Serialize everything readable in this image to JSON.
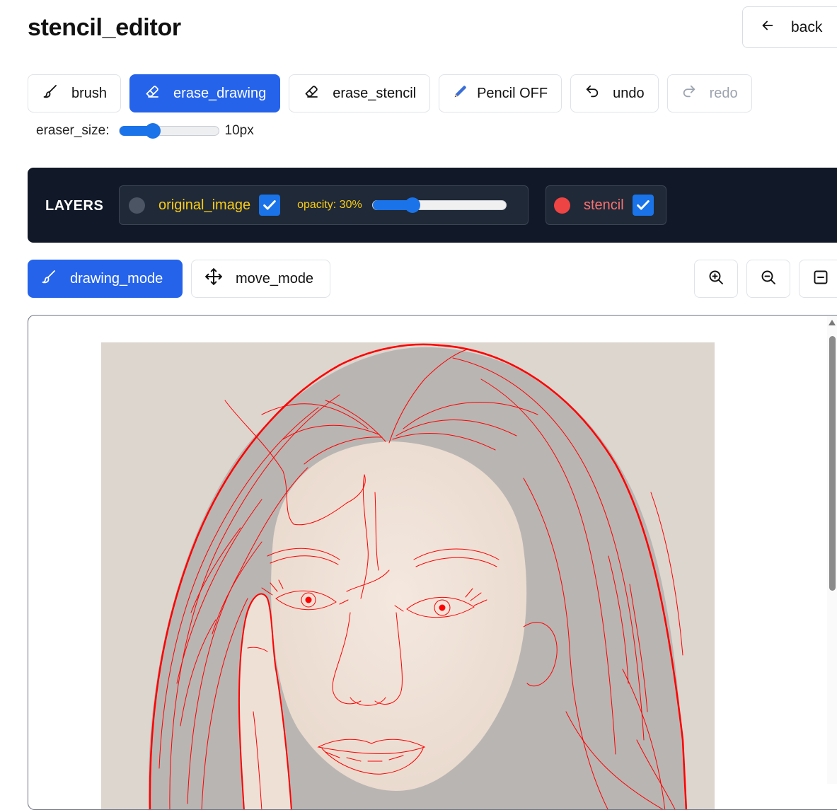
{
  "header": {
    "title": "stencil_editor",
    "back_label": "back"
  },
  "tools": [
    {
      "id": "brush",
      "label": "brush",
      "icon": "brush-icon",
      "state": "normal"
    },
    {
      "id": "erase_drawing",
      "label": "erase_drawing",
      "icon": "eraser-icon",
      "state": "active"
    },
    {
      "id": "erase_stencil",
      "label": "erase_stencil",
      "icon": "eraser-icon",
      "state": "normal"
    },
    {
      "id": "pencil",
      "label": "Pencil OFF",
      "icon": "pencil-icon",
      "state": "normal"
    },
    {
      "id": "undo",
      "label": "undo",
      "icon": "undo-icon",
      "state": "normal"
    },
    {
      "id": "redo",
      "label": "redo",
      "icon": "redo-icon",
      "state": "disabled"
    }
  ],
  "eraser": {
    "label": "eraser_size:",
    "value_text": "10px",
    "level": 0.34
  },
  "layers": {
    "label": "LAYERS",
    "original_image": {
      "label": "original_image",
      "checked": true,
      "opacity_label": "opacity: 30%",
      "opacity": 0.3,
      "dot_color": "#4b5563",
      "label_color": "#facc15"
    },
    "stencil": {
      "label": "stencil",
      "checked": true,
      "dot_color": "#ef4444",
      "label_color": "#f87171"
    }
  },
  "modes": [
    {
      "id": "drawing_mode",
      "label": "drawing_mode",
      "icon": "brush-icon",
      "active": true
    },
    {
      "id": "move_mode",
      "label": "move_mode",
      "icon": "move-icon",
      "active": false
    }
  ],
  "zoom_controls": [
    "zoom-in-icon",
    "zoom-out-icon",
    "fit-icon"
  ],
  "colors": {
    "accent": "#2563eb",
    "stencil_line": "#ff0000",
    "panel_bg": "#111827",
    "photo_bg": "#ddd6cf"
  }
}
